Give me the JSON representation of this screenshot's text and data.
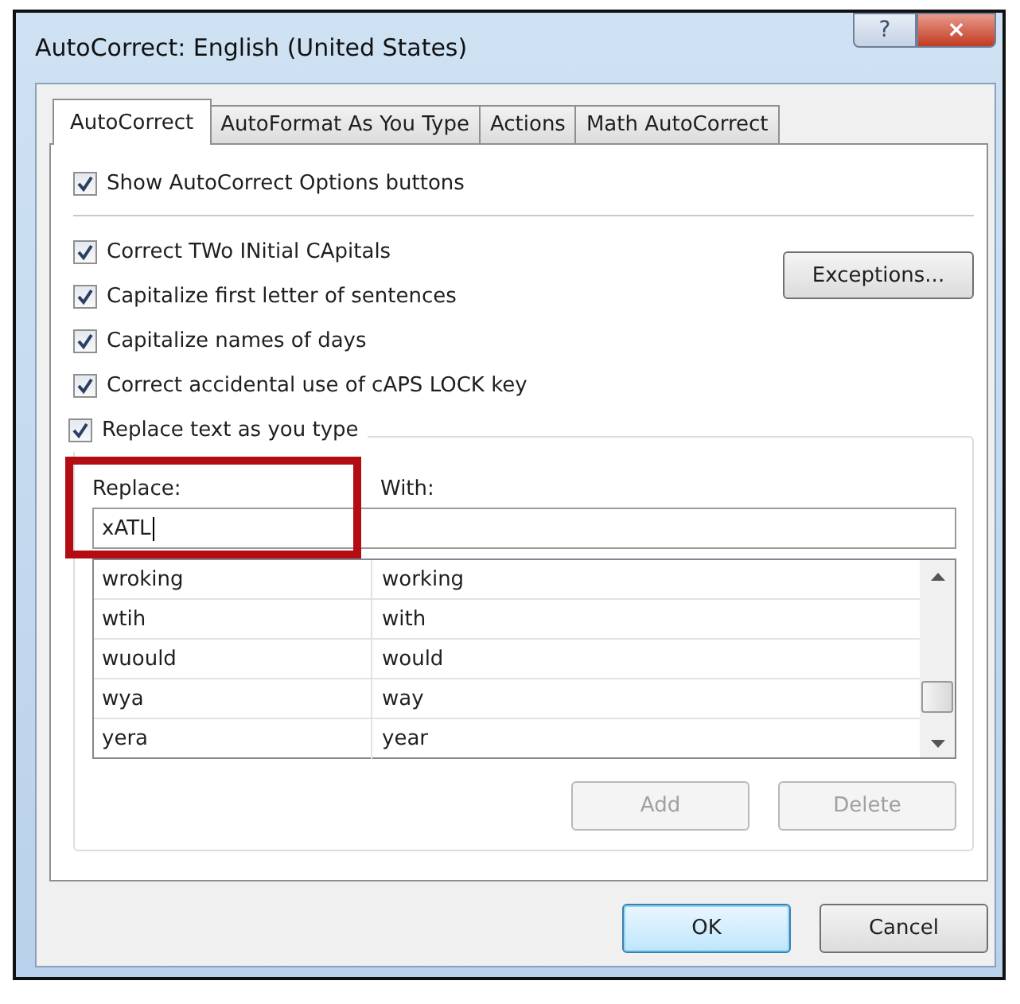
{
  "window": {
    "title": "AutoCorrect: English (United States)",
    "help_button": "?",
    "close_button": "×"
  },
  "tabs": [
    {
      "label": "AutoCorrect",
      "selected": true
    },
    {
      "label": "AutoFormat As You Type",
      "selected": false
    },
    {
      "label": "Actions",
      "selected": false
    },
    {
      "label": "Math AutoCorrect",
      "selected": false
    }
  ],
  "show_options": {
    "label": "Show AutoCorrect Options buttons",
    "checked": true
  },
  "options": [
    {
      "label": "Correct TWo INitial CApitals",
      "checked": true
    },
    {
      "label": "Capitalize first letter of sentences",
      "checked": true
    },
    {
      "label": "Capitalize names of days",
      "checked": true
    },
    {
      "label": "Correct accidental use of cAPS LOCK key",
      "checked": true
    }
  ],
  "exceptions_button": "Exceptions...",
  "replace_group": {
    "label": "Replace text as you type",
    "checked": true,
    "replace_label": "Replace:",
    "with_label": "With:",
    "replace_value": "xATL",
    "entries": [
      {
        "replace": "wroking",
        "with": "working"
      },
      {
        "replace": "wtih",
        "with": "with"
      },
      {
        "replace": "wuould",
        "with": "would"
      },
      {
        "replace": "wya",
        "with": "way"
      },
      {
        "replace": "yera",
        "with": "year"
      }
    ],
    "add_button": {
      "label": "Add",
      "disabled": true
    },
    "delete_button": {
      "label": "Delete",
      "disabled": true
    }
  },
  "ok_button": "OK",
  "cancel_button": "Cancel"
}
